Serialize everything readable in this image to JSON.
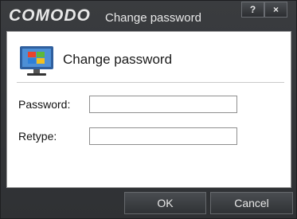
{
  "window": {
    "brand": "COMODO",
    "title": "Change password",
    "help_label": "?",
    "close_label": "×"
  },
  "header": {
    "title": "Change password",
    "icon": "monitor-windows-icon"
  },
  "form": {
    "password_label": "Password:",
    "password_value": "",
    "retype_label": "Retype:",
    "retype_value": ""
  },
  "footer": {
    "ok_label": "OK",
    "cancel_label": "Cancel"
  }
}
